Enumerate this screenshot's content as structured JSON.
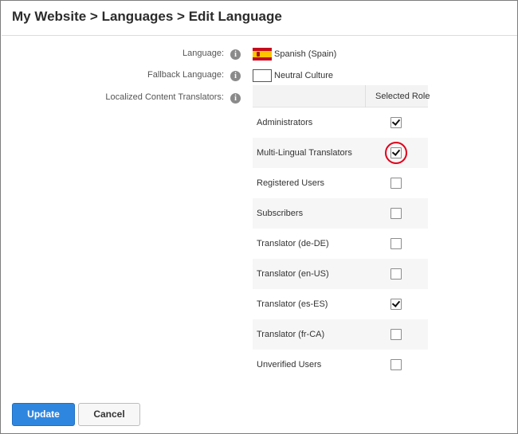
{
  "header": {
    "title": "My Website > Languages > Edit Language"
  },
  "form": {
    "language_label": "Language:",
    "language_value": "Spanish (Spain)",
    "fallback_label": "Fallback Language:",
    "fallback_value": "Neutral Culture",
    "translators_label": "Localized Content Translators:"
  },
  "roles_table": {
    "column_header": "Selected Role",
    "rows": [
      {
        "name": "Administrators",
        "checked": true
      },
      {
        "name": "Multi-Lingual Translators",
        "checked": true
      },
      {
        "name": "Registered Users",
        "checked": false
      },
      {
        "name": "Subscribers",
        "checked": false
      },
      {
        "name": "Translator (de-DE)",
        "checked": false
      },
      {
        "name": "Translator (en-US)",
        "checked": false
      },
      {
        "name": "Translator (es-ES)",
        "checked": true
      },
      {
        "name": "Translator (fr-CA)",
        "checked": false
      },
      {
        "name": "Unverified Users",
        "checked": false
      }
    ]
  },
  "actions": {
    "update_label": "Update",
    "cancel_label": "Cancel"
  },
  "colors": {
    "primary_button": "#2f86df",
    "highlight_ring": "#e2001a"
  },
  "icons": {
    "info": "info-icon",
    "language_flag": "spain-flag-icon",
    "fallback_flag": "neutral-culture-flag-icon",
    "checkbox_tick": "checkmark-icon"
  }
}
